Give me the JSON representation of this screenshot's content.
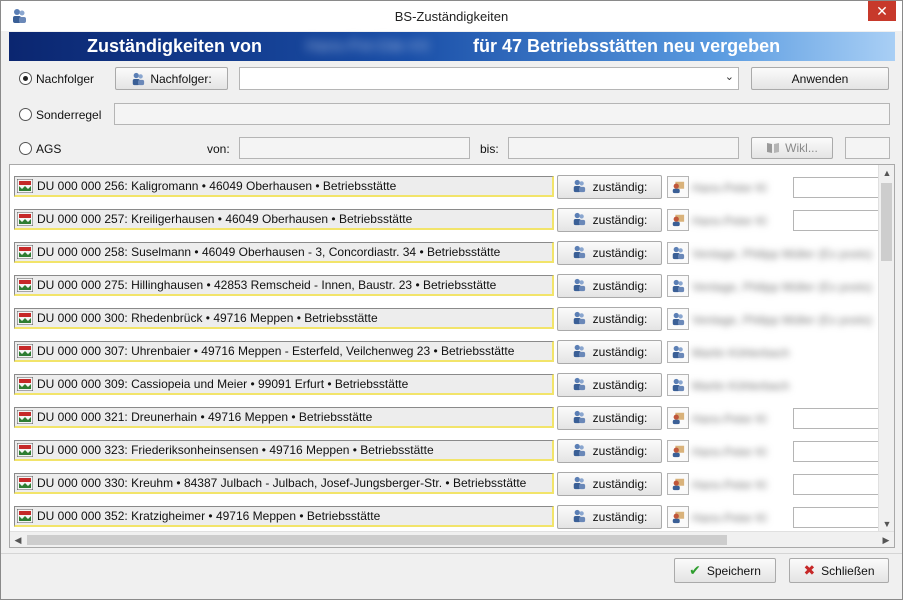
{
  "window": {
    "title": "BS-Zuständigkeiten",
    "close_label": "✕"
  },
  "banner": {
    "prefix": "Zuständigkeiten von",
    "name_blurred": "Hans-Pet-Dät-XX",
    "suffix": "für 47 Betriebsstätten neu vergeben"
  },
  "options": {
    "nachfolger_label": "Nachfolger",
    "nachfolger_button": "Nachfolger:",
    "nachfolger_value": "",
    "apply_button": "Anwenden",
    "sonderregel_label": "Sonderregel",
    "ags_label": "AGS",
    "von_label": "von:",
    "bis_label": "bis:",
    "wiki_button": "Wikl..."
  },
  "list": {
    "assign_label": "zuständig:",
    "rows": [
      {
        "text": "DU  000 000 256: Kaligromann • 46049 Oberhausen • Betriebsstätte",
        "person": "Hans-Peter Kl",
        "person_icon": "person-card-icon"
      },
      {
        "text": "DU  000 000 257: Kreiligerhausen • 46049 Oberhausen • Betriebsstätte",
        "person": "Hans-Peter Kl",
        "person_icon": "person-card-icon"
      },
      {
        "text": "DU  000 000 258: Suselmann • 46049 Oberhausen - 3, Concordiastr. 34 • Betriebsstätte",
        "person": "Ventage, Philipp Müller (Ex posts)",
        "person_icon": "people-icon"
      },
      {
        "text": "DU  000 000 275: Hillinghausen • 42853 Remscheid - Innen, Baustr. 23 • Betriebsstätte",
        "person": "Ventage, Philipp Müller (Ex posts)",
        "person_icon": "people-icon"
      },
      {
        "text": "DU  000 000 300: Rhedenbrück • 49716 Meppen • Betriebsstätte",
        "person": "Ventage, Philipp Müller (Ex posts)",
        "person_icon": "people-icon"
      },
      {
        "text": "DU  000 000 307: Uhrenbaier • 49716 Meppen - Esterfeld, Veilchenweg 23 • Betriebsstätte",
        "person": "Martin Köhlerbach",
        "person_icon": "people-icon"
      },
      {
        "text": "DU  000 000 309: Cassiopeia und Meier • 99091 Erfurt • Betriebsstätte",
        "person": "Martin Köhlerbach",
        "person_icon": "people-icon"
      },
      {
        "text": "DU  000 000 321: Dreunerhain • 49716 Meppen • Betriebsstätte",
        "person": "Hans-Peter Kl",
        "person_icon": "person-card-icon"
      },
      {
        "text": "DU  000 000 323: Friederiksonheinsensen • 49716 Meppen • Betriebsstätte",
        "person": "Hans-Peter Kl",
        "person_icon": "person-card-icon"
      },
      {
        "text": "DU  000 000 330: Kreuhm • 84387 Julbach - Julbach, Josef-Jungsberger-Str. • Betriebsstätte",
        "person": "Hans-Peter Kl",
        "person_icon": "person-card-icon"
      },
      {
        "text": "DU  000 000 352: Kratzigheimer • 49716 Meppen • Betriebsstätte",
        "person": "Hans-Peter Kl",
        "person_icon": "person-card-icon"
      }
    ]
  },
  "footer": {
    "save_button": "Speichern",
    "close_button": "Schließen"
  },
  "colors": {
    "banner_dark": "#0b2670",
    "banner_light": "#a9cff5",
    "row_highlight": "#f2e46a",
    "save_check": "#2e9e2e",
    "close_x": "#c62828"
  }
}
